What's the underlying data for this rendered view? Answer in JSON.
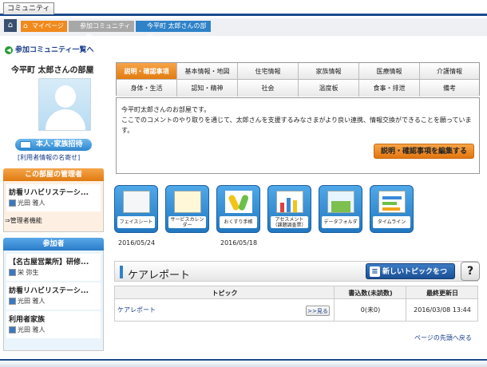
{
  "header": {
    "community_tab": "コミュニティ",
    "home_icon": "home-icon",
    "breadcrumb": [
      "マイページ",
      "参加コミュニティ一覧",
      "今平町 太郎さんの部屋"
    ]
  },
  "back_link": "参加コミュニティ一覧へ",
  "sidebar": {
    "room_title": "今平町 太郎さんの部屋",
    "invite_label": "本人･家族招待",
    "name_card_label": "[利用者情報の名寄せ]",
    "admin_section": {
      "title": "この部屋の管理者",
      "org": "訪看リハビリステーシ...",
      "person": "光田 雅人",
      "function_label": "⇒管理者機能"
    },
    "participants_section": {
      "title": "参加者",
      "groups": [
        {
          "org": "【名古屋営業所】研修...",
          "person": "栄 弥生"
        },
        {
          "org": "訪看リハビリステーシ...",
          "person": "光田 雅人"
        },
        {
          "org": "利用者家族",
          "person": "光田 雅人"
        }
      ]
    }
  },
  "tabs": {
    "row1": [
      "説明・確認事項",
      "基本情報・地図",
      "住宅情報",
      "家族情報",
      "医療情報",
      "介護情報"
    ],
    "row2": [
      "身体・生活",
      "認知・精神",
      "社会",
      "温度板",
      "食事・排泄",
      "備考"
    ],
    "active": "説明・確認事項"
  },
  "description": {
    "lines": [
      "今平町太郎さんのお部屋です。",
      "ここでのコメントのやり取りを通じて、太郎さんを支援するみなさまがより良い連携、情報交換ができることを願っていま",
      "す。"
    ],
    "edit_button": "説明・確認事項を編集する"
  },
  "tiles": [
    {
      "label": "フェイスシート",
      "date": "2016/05/24",
      "icon": "face-sheet-icon"
    },
    {
      "label": "サービスカレンダー",
      "date": "",
      "icon": "calendar-icon"
    },
    {
      "label": "おくすり手帳",
      "date": "2016/05/18",
      "icon": "medicine-icon"
    },
    {
      "label": "アセスメント（課題調査票）",
      "date": "",
      "icon": "assessment-icon"
    },
    {
      "label": "データフォルダ",
      "date": "",
      "icon": "folder-icon"
    },
    {
      "label": "タイムライン",
      "date": "",
      "icon": "timeline-icon"
    }
  ],
  "care_report": {
    "title": "ケアレポート",
    "new_topic_button": "新しいトピックをつくる",
    "help_label": "?",
    "columns": [
      "トピック",
      "書込数(未読数)",
      "最終更新日"
    ],
    "rows": [
      {
        "topic": "ケアレポート",
        "view_label": ">>見る",
        "count": "0(未0)",
        "updated": "2016/03/08 13:44"
      }
    ]
  },
  "page_top_link": "ページの先頭へ戻る",
  "colors": {
    "accent_orange": "#f08a1c",
    "accent_blue": "#2f82c8",
    "navy": "#1a4a8c"
  }
}
